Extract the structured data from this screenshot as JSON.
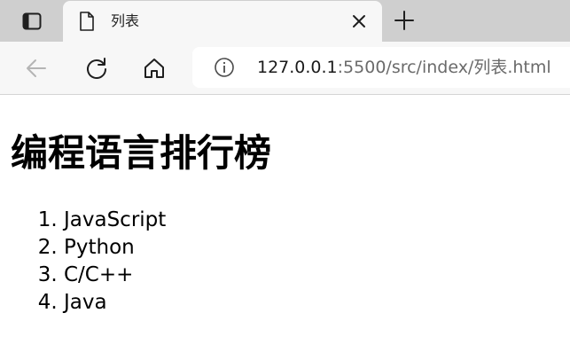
{
  "browser": {
    "tab": {
      "title": "列表"
    },
    "address": {
      "host": "127.0.0.1",
      "path": ":5500/src/index/列表.html"
    },
    "icons": {
      "tab_actions": "tab-actions-icon",
      "page": "document-icon",
      "close": "close-icon",
      "new_tab": "plus-icon",
      "back": "back-arrow-icon",
      "reload": "reload-icon",
      "home": "home-icon",
      "info": "info-icon"
    }
  },
  "page": {
    "heading": "编程语言排行榜",
    "languages": [
      "JavaScript",
      "Python",
      "C/C++",
      "Java"
    ]
  }
}
